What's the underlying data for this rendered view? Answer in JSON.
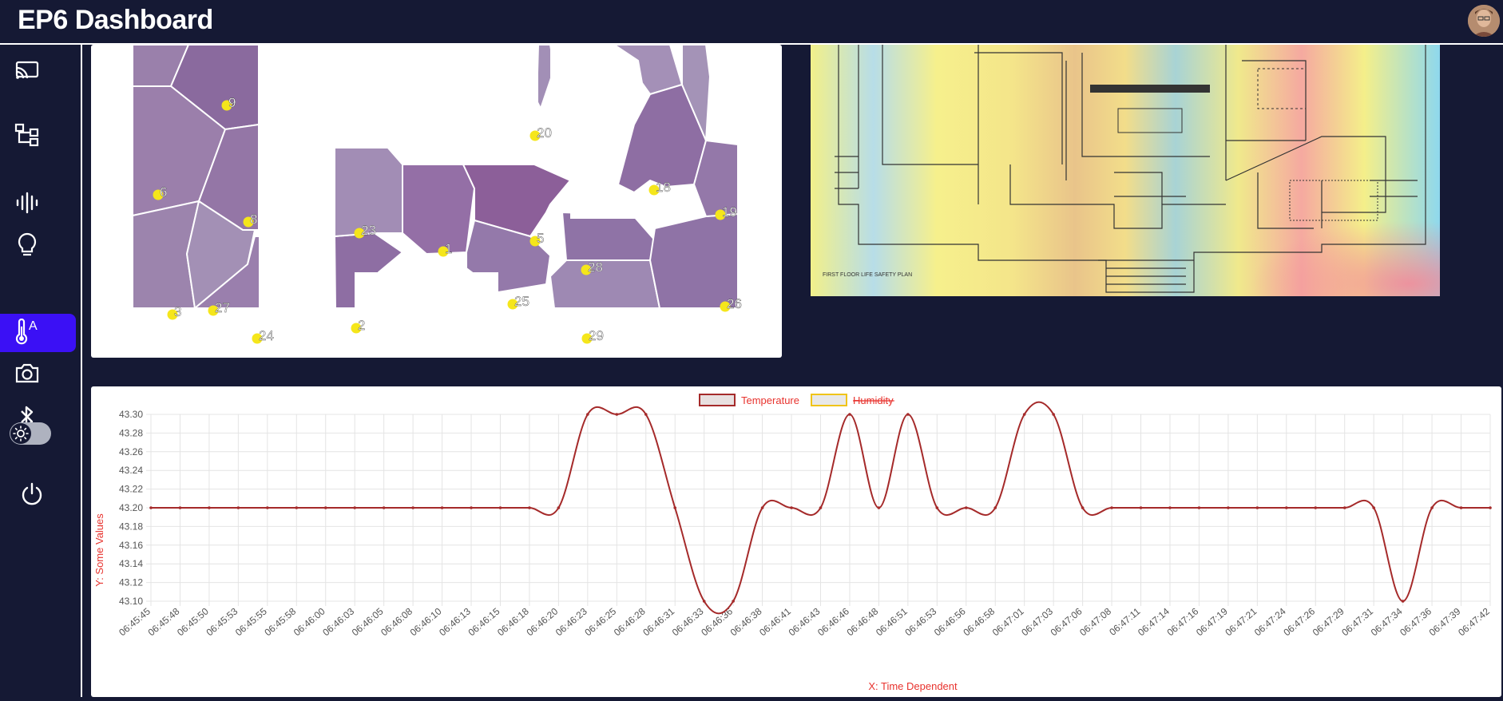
{
  "header": {
    "title": "EP6 Dashboard"
  },
  "sidebar": {
    "items": [
      {
        "icon": "cast-icon"
      },
      {
        "icon": "sitemap-icon"
      },
      {
        "icon": "audio-waveform-icon"
      },
      {
        "icon": "lightbulb-icon"
      },
      {
        "icon": "thermometer-icon",
        "active": true
      },
      {
        "icon": "camera-icon"
      },
      {
        "icon": "bluetooth-icon"
      },
      {
        "icon": "theme-toggle-icon"
      },
      {
        "icon": "power-icon"
      }
    ]
  },
  "voronoi": {
    "labels": [
      "9",
      "20",
      "6",
      "18",
      "8",
      "19",
      "23",
      "5",
      "1",
      "28",
      "3",
      "27",
      "25",
      "26",
      "24",
      "2",
      "29"
    ]
  },
  "heatmap": {
    "caption": "FIRST FLOOR LIFE SAFETY PLAN"
  },
  "colors": {
    "background": "#151934",
    "accent": "#3b10f5",
    "series": "#a52a2a",
    "label_red": "#e8332e"
  },
  "chart_data": {
    "type": "line",
    "legend": [
      {
        "name": "Temperature",
        "color": "#a52a2a",
        "hidden": false
      },
      {
        "name": "Humidity",
        "color": "#f0c419",
        "hidden": true
      }
    ],
    "xlabel": "X: Time Dependent",
    "ylabel": "Y: Some Values",
    "ylim": [
      43.1,
      43.3
    ],
    "yticks": [
      "43.30",
      "43.28",
      "43.26",
      "43.24",
      "43.22",
      "43.20",
      "43.18",
      "43.16",
      "43.14",
      "43.12",
      "43.10"
    ],
    "categories": [
      "06:45:45",
      "06:45:48",
      "06:45:50",
      "06:45:53",
      "06:45:55",
      "06:45:58",
      "06:46:00",
      "06:46:03",
      "06:46:05",
      "06:46:08",
      "06:46:10",
      "06:46:13",
      "06:46:15",
      "06:46:18",
      "06:46:20",
      "06:46:23",
      "06:46:25",
      "06:46:28",
      "06:46:31",
      "06:46:33",
      "06:46:36",
      "06:46:38",
      "06:46:41",
      "06:46:43",
      "06:46:46",
      "06:46:48",
      "06:46:51",
      "06:46:53",
      "06:46:56",
      "06:46:58",
      "06:47:01",
      "06:47:03",
      "06:47:06",
      "06:47:08",
      "06:47:11",
      "06:47:14",
      "06:47:16",
      "06:47:19",
      "06:47:21",
      "06:47:24",
      "06:47:26",
      "06:47:29",
      "06:47:31",
      "06:47:34",
      "06:47:36",
      "06:47:39",
      "06:47:42"
    ],
    "series": [
      {
        "name": "Temperature",
        "values": [
          43.2,
          43.2,
          43.2,
          43.2,
          43.2,
          43.2,
          43.2,
          43.2,
          43.2,
          43.2,
          43.2,
          43.2,
          43.2,
          43.2,
          43.2,
          43.3,
          43.3,
          43.3,
          43.2,
          43.1,
          43.1,
          43.2,
          43.2,
          43.2,
          43.3,
          43.2,
          43.3,
          43.2,
          43.2,
          43.2,
          43.3,
          43.3,
          43.2,
          43.2,
          43.2,
          43.2,
          43.2,
          43.2,
          43.2,
          43.2,
          43.2,
          43.2,
          43.2,
          43.1,
          43.2,
          43.2,
          43.2
        ]
      }
    ],
    "grid": true,
    "legend_position": "top-center"
  }
}
